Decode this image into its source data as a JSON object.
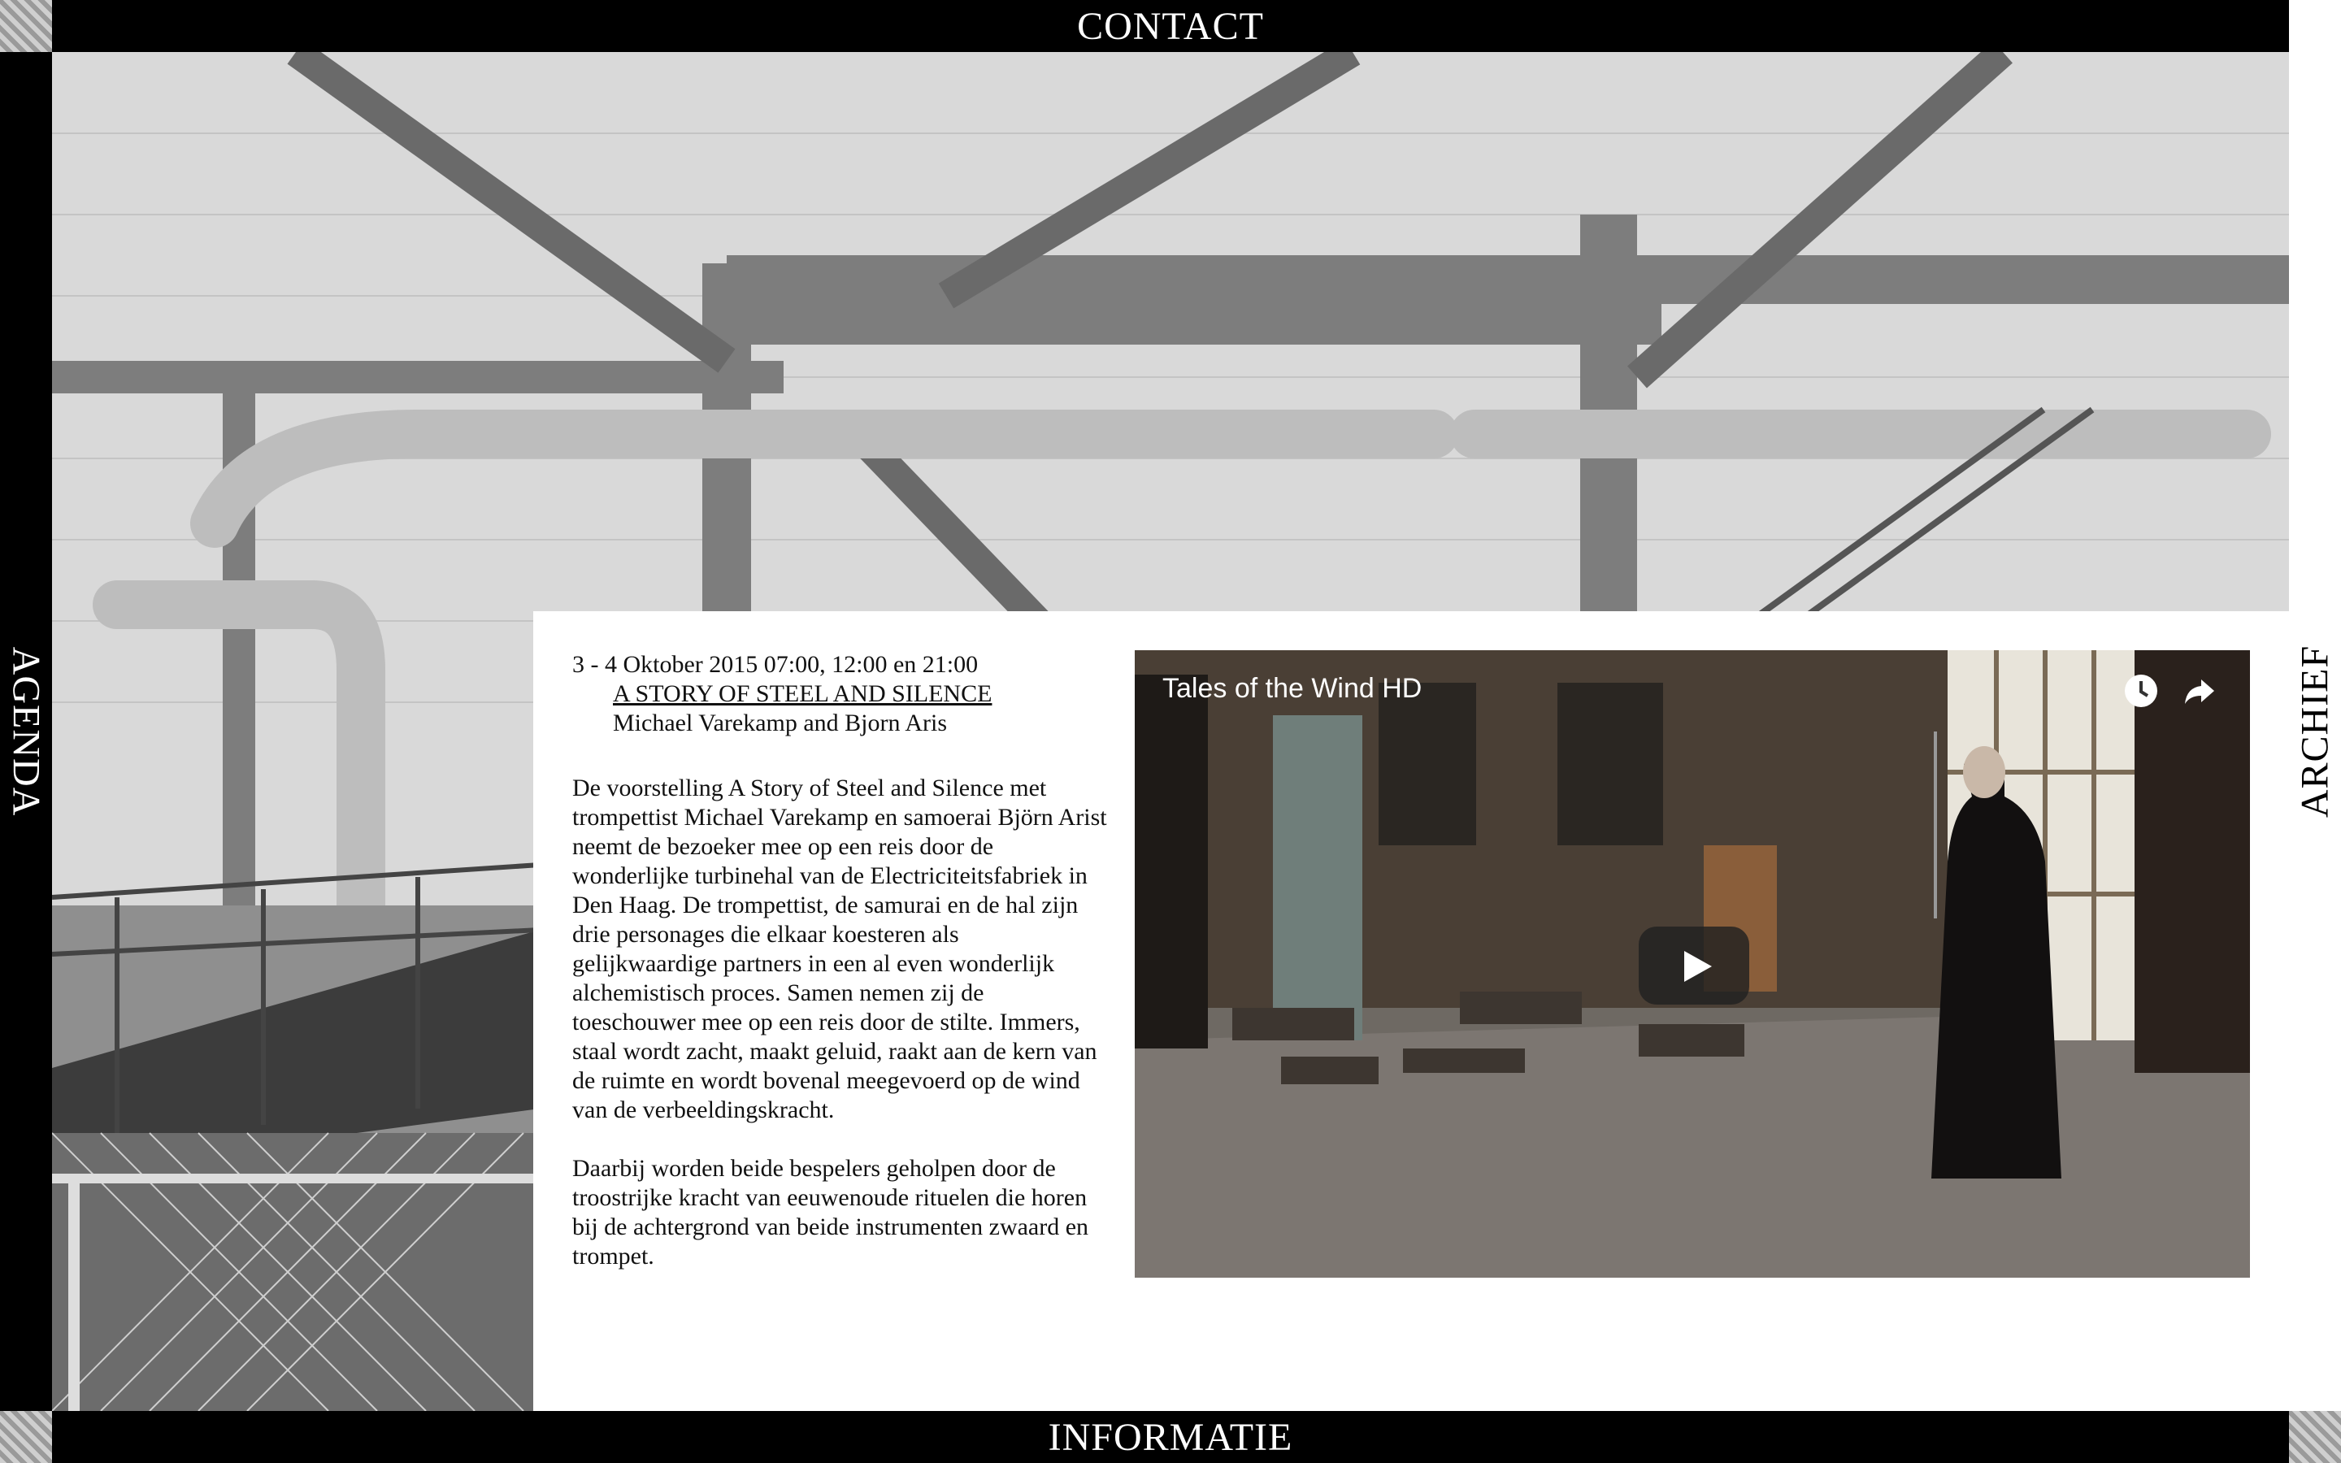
{
  "nav": {
    "top": "CONTACT",
    "bottom": "INFORMATIE",
    "left": "AGENDA",
    "right": "ARCHIEF"
  },
  "event": {
    "date": "3 - 4 Oktober 2015 07:00, 12:00 en 21:00",
    "title": "A STORY OF STEEL AND SILENCE",
    "artists": "Michael Varekamp and Bjorn Aris",
    "description_1": "De voorstelling A Story of Steel and Silence met trompettist Michael Varekamp en samoerai Björn Arist neemt de bezoeker mee op een reis door de wonderlijke turbinehal van de Electriciteitsfabriek in Den Haag. De trompettist, de samurai en de hal zijn drie personages die elkaar koesteren als gelijkwaardige partners in een al even wonderlijk alchemistisch proces. Samen nemen zij de toeschouwer mee op een reis door de stilte. Immers, staal wordt zacht, maakt geluid, raakt aan de kern van de ruimte en wordt bovenal meegevoerd op de wind van de verbeeldingskracht.",
    "description_2": "Daarbij worden beide bespelers geholpen door de troostrijke kracht van eeuwenoude rituelen die horen bij de achtergrond van beide instrumenten zwaard en trompet."
  },
  "video": {
    "title": "Tales of the Wind HD",
    "icons": [
      "clock-icon",
      "share-icon",
      "play-icon"
    ]
  }
}
